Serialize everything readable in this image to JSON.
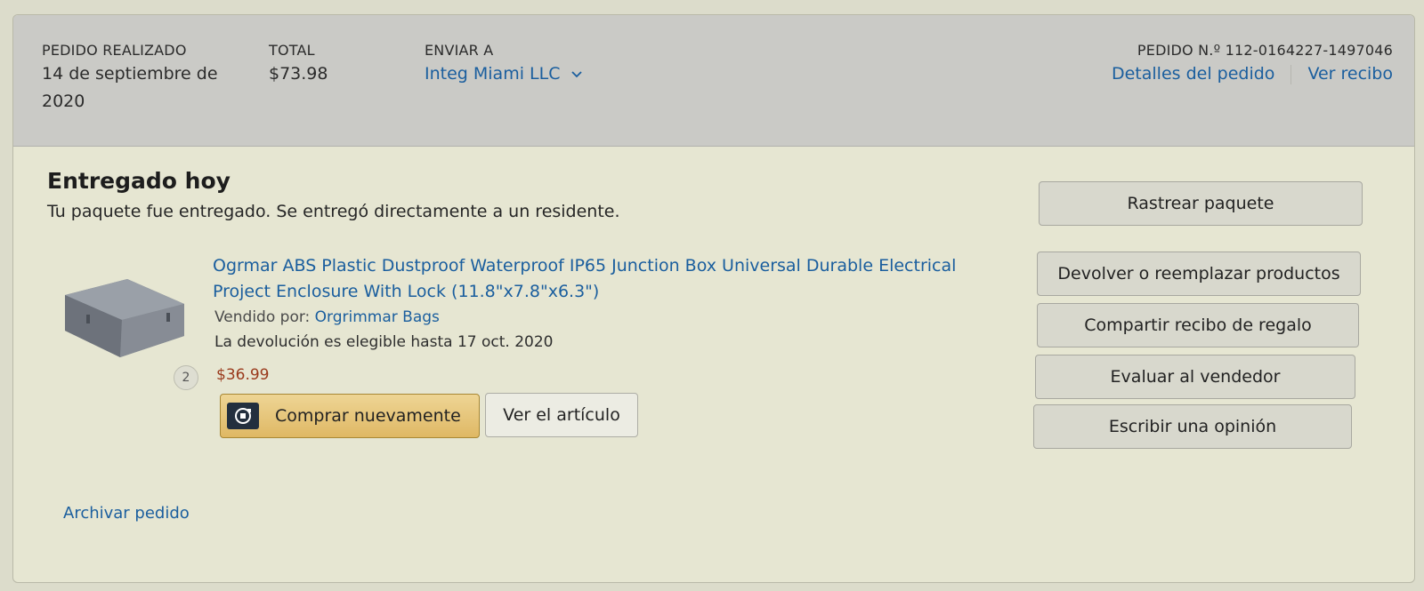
{
  "header": {
    "placed_label": "PEDIDO REALIZADO",
    "placed_value": "14 de septiembre de 2020",
    "total_label": "TOTAL",
    "total_value": "$73.98",
    "ship_label": "ENVIAR A",
    "ship_value": "Integ Miami LLC",
    "order_number": "PEDIDO N.º 112-0164227-1497046",
    "details_link": "Detalles del pedido",
    "receipt_link": "Ver recibo"
  },
  "shipment": {
    "status_title": "Entregado hoy",
    "status_detail": "Tu paquete fue entregado. Se entregó directamente a un residente."
  },
  "item": {
    "title": "Ogrmar ABS Plastic Dustproof Waterproof IP65 Junction Box Universal Durable Electrical Project Enclosure With Lock (11.8\"x7.8\"x6.3\")",
    "sold_by_label": "Vendido por:",
    "seller": "Orgrimmar Bags",
    "return_window": "La devolución es elegible hasta 17 oct. 2020",
    "quantity": "2",
    "price": "$36.99",
    "buy_again": "Comprar nuevamente",
    "view_item": "Ver el artículo"
  },
  "actions": {
    "track": "Rastrear paquete",
    "return": "Devolver o reemplazar productos",
    "gift_receipt": "Compartir recibo de regalo",
    "rate_seller": "Evaluar al vendedor",
    "write_review": "Escribir una opinión"
  },
  "footer": {
    "archive": "Archivar pedido"
  },
  "colors": {
    "link": "#1a5e9e",
    "price": "#9a3a1c",
    "buy_button": "#e4c172"
  },
  "icons": {
    "ship_dropdown": "chevron-down-icon",
    "buy_again": "reorder-icon"
  }
}
